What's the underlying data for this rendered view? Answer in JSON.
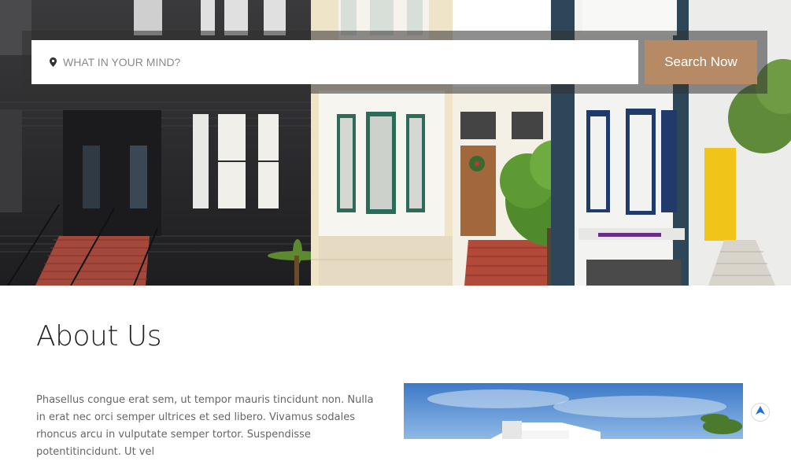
{
  "search": {
    "placeholder": "WHAT IN YOUR MIND?",
    "value": "",
    "button_label": "Search Now",
    "pin_icon": "map-pin-icon"
  },
  "about": {
    "title": "About Us",
    "paragraph": "Phasellus congue erat sem, ut tempor mauris tincidunt non. Nulla in erat nec orci semper ultrices et sed libero. Vivamus sodales rhoncus arcu in vulputate semper tortor. Suspendisse potentitincidunt. Ut vel"
  },
  "scroll_top": {
    "icon": "arrow-up-icon"
  },
  "colors": {
    "accent": "#b58a65",
    "search_bar_overlay": "rgba(50,50,50,0.55)",
    "title": "#222222",
    "body_text": "#666666",
    "scroll_arrow": "#1e6fd9"
  }
}
